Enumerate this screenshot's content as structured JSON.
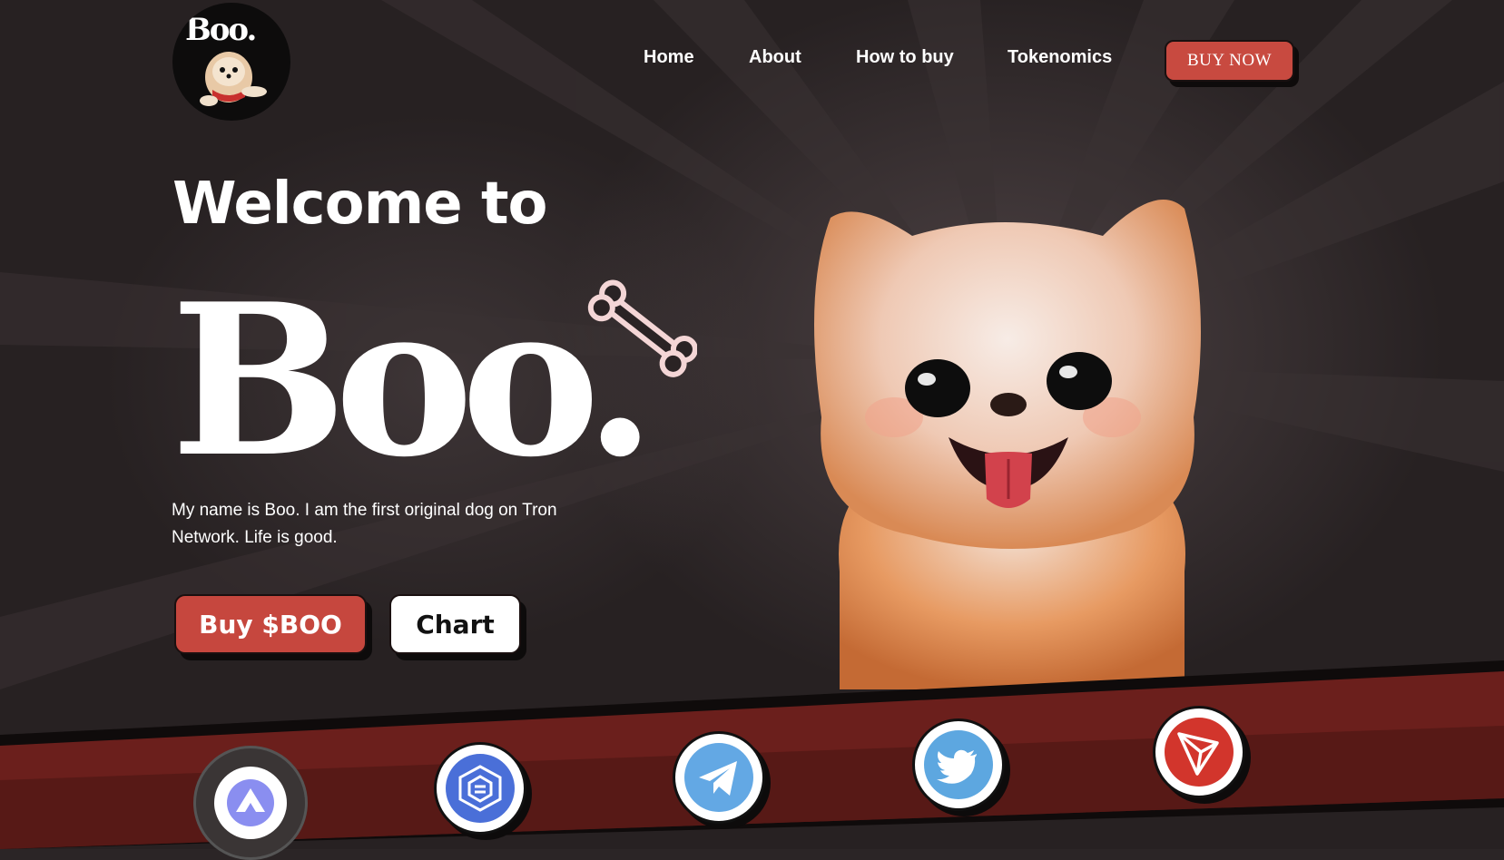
{
  "header": {
    "logo_text": "Boo.",
    "nav": [
      {
        "label": "Home"
      },
      {
        "label": "About"
      },
      {
        "label": "How to buy"
      },
      {
        "label": "Tokenomics"
      }
    ],
    "buy_now_label": "BUY NOW"
  },
  "hero": {
    "welcome": "Welcome to",
    "title": "Boo.",
    "description": "My name is Boo. I am the first original dog on Tron Network. Life is good.",
    "buy_button": "Buy $BOO",
    "chart_button": "Chart"
  },
  "socials": [
    {
      "icon": "sunpump-icon"
    },
    {
      "icon": "cube-exchange-icon"
    },
    {
      "icon": "telegram-icon"
    },
    {
      "icon": "twitter-icon"
    },
    {
      "icon": "tron-icon"
    }
  ],
  "colors": {
    "accent": "#c6473e",
    "background": "#272122",
    "band": "#6b1f1c"
  }
}
